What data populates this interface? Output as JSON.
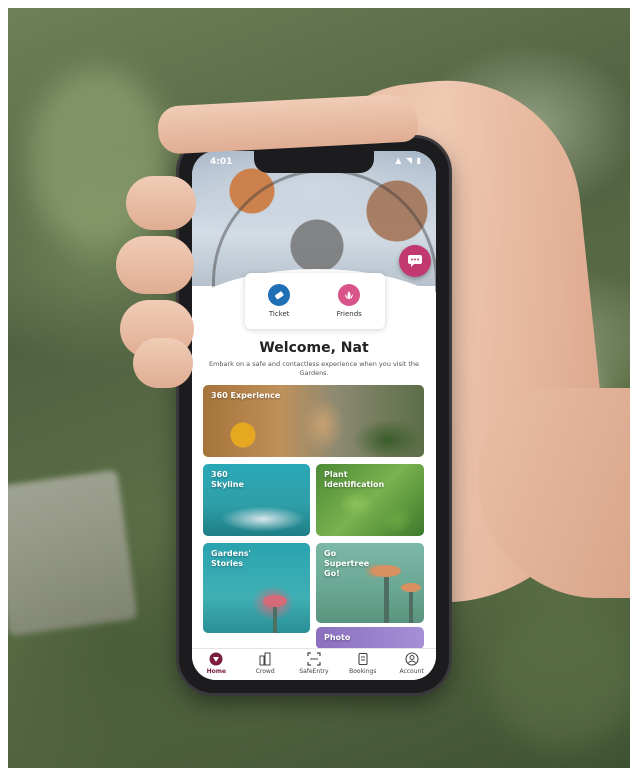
{
  "status_bar": {
    "time": "4:01",
    "icons": "▲ ◥ ▮"
  },
  "bg_sign_text": "",
  "quick_actions": [
    {
      "label": "Ticket",
      "icon": "ticket-icon",
      "color": "#1f6fb5"
    },
    {
      "label": "Friends",
      "icon": "lotus-icon",
      "color": "#d9548a"
    }
  ],
  "welcome": {
    "title": "Welcome, Nat",
    "subtitle": "Embark on a safe and contactless experience when you visit the Gardens."
  },
  "tiles": {
    "experience": "360 Experience",
    "skyline": "360\nSkyline",
    "plant": "Plant\nIdentification",
    "stories": "Gardens'\nStories",
    "supertree": "Go\nSupertree\nGo!",
    "photo": "Photo"
  },
  "tabs": [
    {
      "label": "Home",
      "icon": "home-icon",
      "active": true
    },
    {
      "label": "Crowd",
      "icon": "crowd-icon",
      "active": false
    },
    {
      "label": "SafeEntry",
      "icon": "scan-icon",
      "active": false
    },
    {
      "label": "Bookings",
      "icon": "bookings-icon",
      "active": false
    },
    {
      "label": "Account",
      "icon": "account-icon",
      "active": false
    }
  ],
  "colors": {
    "accent": "#c2396f",
    "tab_active": "#7a1d3a"
  }
}
